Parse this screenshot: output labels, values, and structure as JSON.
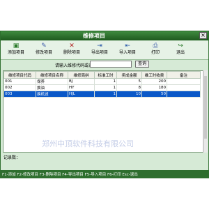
{
  "window": {
    "title": "维修项目",
    "close_label": "×"
  },
  "toolbar": [
    {
      "label": "添加项目",
      "icon": "add-icon",
      "glyph": "▣"
    },
    {
      "label": "修改项目",
      "icon": "edit-icon",
      "glyph": "✎"
    },
    {
      "label": "删除项目",
      "icon": "delete-icon",
      "glyph": "✕"
    },
    {
      "label": "导出项目",
      "icon": "export-icon",
      "glyph": "⇥"
    },
    {
      "label": "导入项目",
      "icon": "import-icon",
      "glyph": "⇤"
    },
    {
      "label": "打印",
      "icon": "print-icon",
      "glyph": "⎙"
    },
    {
      "label": "退出",
      "icon": "exit-icon",
      "glyph": "↪"
    }
  ],
  "search": {
    "label": "请输入维修代码或名称：",
    "value": "",
    "button": "查询"
  },
  "table": {
    "columns": [
      "维修项目代码",
      "维修项目名称",
      "维修简拼",
      "标准工时",
      "奖成金额",
      "维工时收费",
      "备注"
    ],
    "rows": [
      [
        "001",
        "保养",
        "BJ",
        "1",
        "5",
        "200",
        ""
      ],
      [
        "002",
        "换油",
        "HY",
        "1",
        "8",
        "180",
        ""
      ],
      [
        "003",
        "换机滤",
        "HJL",
        "1",
        "10",
        "50",
        ""
      ]
    ],
    "selected_index": 2
  },
  "record_count": "记录数：",
  "status": "F1-添加 F2-修改项目 F3-删除项目 F4-导出项目 F5-导入项目 F6-打印 Esc-退出",
  "watermark": "郑州中顶软件科技有限公司"
}
